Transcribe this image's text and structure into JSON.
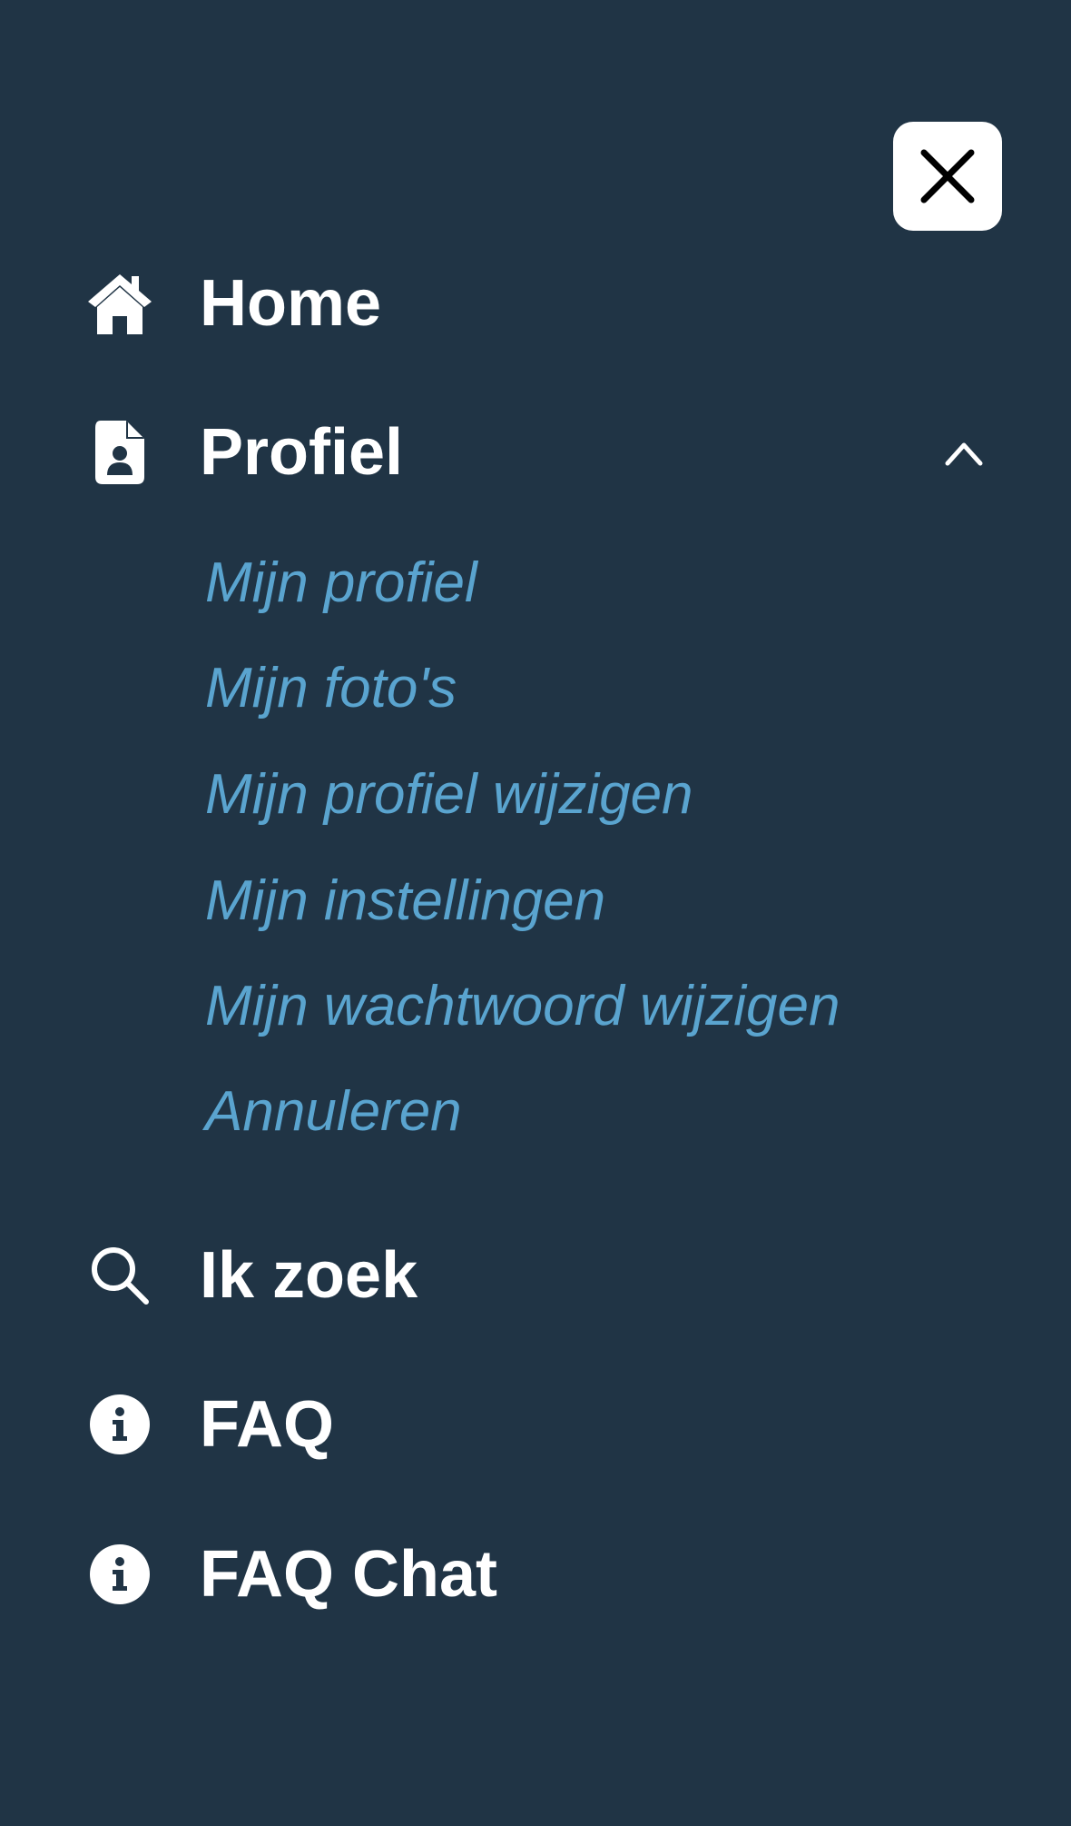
{
  "menu": {
    "close_icon": "close-icon",
    "items": [
      {
        "label": "Home",
        "icon": "home-icon"
      },
      {
        "label": "Profiel",
        "icon": "profile-document-icon",
        "expanded": true,
        "chevron_icon": "chevron-up-icon"
      },
      {
        "label": "Ik zoek",
        "icon": "search-icon"
      },
      {
        "label": "FAQ",
        "icon": "info-icon"
      },
      {
        "label": "FAQ Chat",
        "icon": "info-icon"
      }
    ],
    "profile_submenu": [
      "Mijn profiel",
      "Mijn foto's",
      "Mijn profiel wijzigen",
      "Mijn instellingen",
      "Mijn wachtwoord wijzigen",
      "Annuleren"
    ]
  },
  "colors": {
    "background": "#203445",
    "primary_text": "#ffffff",
    "submenu_text": "#5aa4cf",
    "close_button_bg": "#ffffff"
  }
}
